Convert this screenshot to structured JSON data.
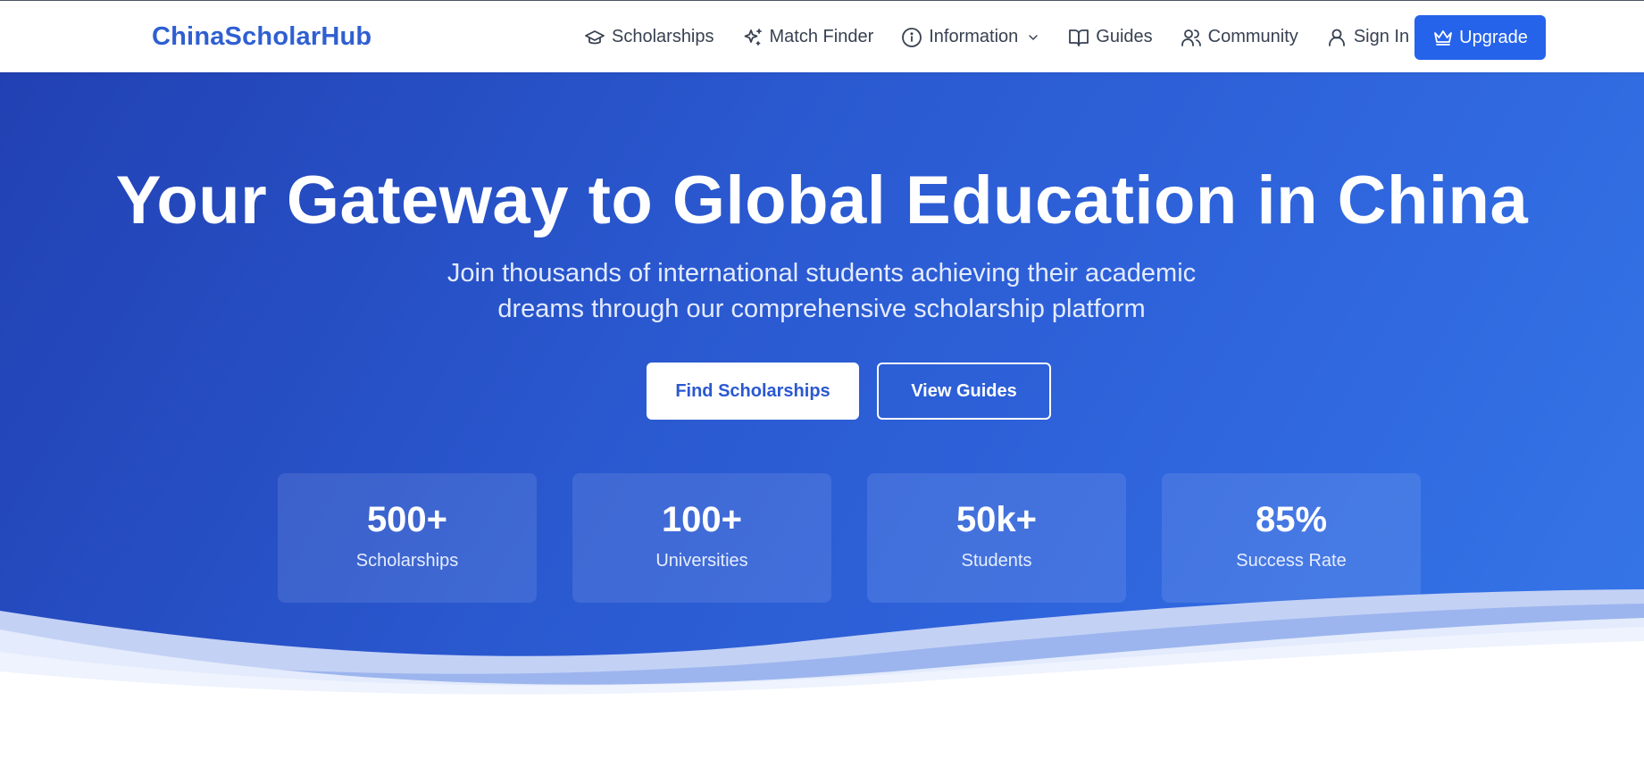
{
  "brand": "ChinaScholarHub",
  "nav": {
    "items": [
      {
        "label": "Scholarships",
        "icon": "graduation-cap-icon"
      },
      {
        "label": "Match Finder",
        "icon": "sparkles-icon"
      },
      {
        "label": "Information",
        "icon": "info-icon",
        "dropdown": true
      },
      {
        "label": "Guides",
        "icon": "book-open-icon"
      },
      {
        "label": "Community",
        "icon": "users-icon"
      },
      {
        "label": "Sign In",
        "icon": "user-icon"
      }
    ],
    "upgrade_label": "Upgrade"
  },
  "hero": {
    "title": "Your Gateway to Global Education in China",
    "subtitle": "Join thousands of international students achieving their academic dreams through our comprehensive scholarship platform",
    "primary_cta": "Find Scholarships",
    "secondary_cta": "View Guides",
    "stats": [
      {
        "value": "500+",
        "label": "Scholarships"
      },
      {
        "value": "100+",
        "label": "Universities"
      },
      {
        "value": "50k+",
        "label": "Students"
      },
      {
        "value": "85%",
        "label": "Success Rate"
      }
    ]
  },
  "colors": {
    "brand": "#2f5fd1",
    "accent": "#2563eb",
    "hero_start": "#2141b3",
    "hero_end": "#3576e8"
  }
}
